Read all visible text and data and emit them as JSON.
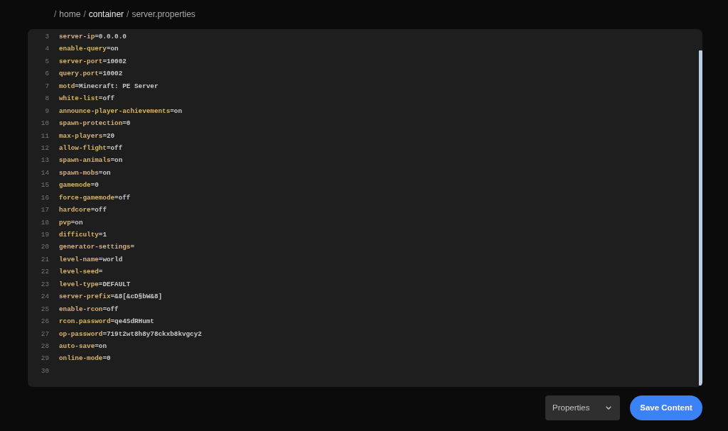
{
  "breadcrumb": [
    {
      "separator": "/",
      "label": "home",
      "emphasis": false
    },
    {
      "separator": "/",
      "label": "container",
      "emphasis": true
    },
    {
      "separator": "/",
      "label": "server.properties",
      "emphasis": false
    }
  ],
  "editor": {
    "lines": [
      {
        "number": "3",
        "key": "server-ip",
        "value": "=0.0.0.0"
      },
      {
        "number": "4",
        "key": "enable-query",
        "value": "=on"
      },
      {
        "number": "5",
        "key": "server-port",
        "value": "=10002"
      },
      {
        "number": "6",
        "key": "query.port",
        "value": "=10002"
      },
      {
        "number": "7",
        "key": "motd",
        "value": "=Minecraft: PE Server"
      },
      {
        "number": "8",
        "key": "white-list",
        "value": "=off"
      },
      {
        "number": "9",
        "key": "announce-player-achievements",
        "value": "=on"
      },
      {
        "number": "10",
        "key": "spawn-protection",
        "value": "=0"
      },
      {
        "number": "11",
        "key": "max-players",
        "value": "=20"
      },
      {
        "number": "12",
        "key": "allow-flight",
        "value": "=off"
      },
      {
        "number": "13",
        "key": "spawn-animals",
        "value": "=on"
      },
      {
        "number": "14",
        "key": "spawn-mobs",
        "value": "=on"
      },
      {
        "number": "15",
        "key": "gamemode",
        "value": "=0"
      },
      {
        "number": "16",
        "key": "force-gamemode",
        "value": "=off"
      },
      {
        "number": "17",
        "key": "hardcore",
        "value": "=off"
      },
      {
        "number": "18",
        "key": "pvp",
        "value": "=on"
      },
      {
        "number": "19",
        "key": "difficulty",
        "value": "=1"
      },
      {
        "number": "20",
        "key": "generator-settings",
        "value": "="
      },
      {
        "number": "21",
        "key": "level-name",
        "value": "=world"
      },
      {
        "number": "22",
        "key": "level-seed",
        "value": "="
      },
      {
        "number": "23",
        "key": "level-type",
        "value": "=DEFAULT"
      },
      {
        "number": "24",
        "key": "server-prefix",
        "value": "=&8[&cD§bW&8]"
      },
      {
        "number": "25",
        "key": "enable-rcon",
        "value": "=off"
      },
      {
        "number": "26",
        "key": "rcon.password",
        "value": "=qe4SdRHumt"
      },
      {
        "number": "27",
        "key": "op-password",
        "value": "=719t2wt8h8y78ckxb8kvgcy2"
      },
      {
        "number": "28",
        "key": "auto-save",
        "value": "=on"
      },
      {
        "number": "29",
        "key": "online-mode",
        "value": "=0"
      },
      {
        "number": "30"
      }
    ]
  },
  "file_type_select": {
    "value": "Properties"
  },
  "save_button": {
    "label": "Save Content"
  }
}
